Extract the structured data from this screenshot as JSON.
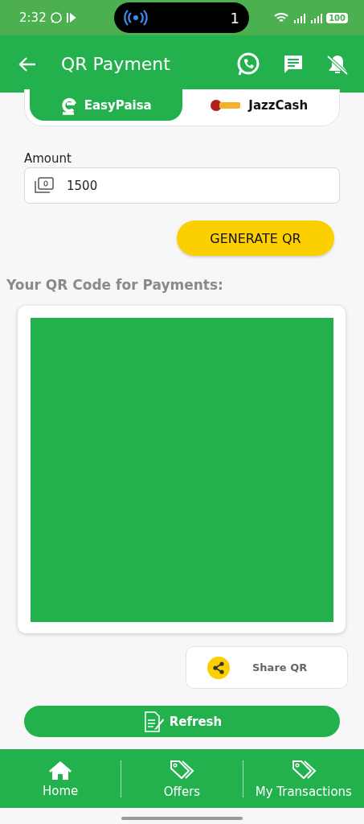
{
  "status_bar": {
    "time": "2:32",
    "notification_count": "1",
    "battery": "100"
  },
  "app_bar": {
    "title": "QR Payment"
  },
  "wallet_tabs": [
    {
      "label": "EasyPaisa",
      "selected": true
    },
    {
      "label": "JazzCash",
      "selected": false
    }
  ],
  "amount": {
    "label": "Amount",
    "value": "1500"
  },
  "generate_button": "GENERATE QR",
  "qr_heading": "Your QR Code for Payments:",
  "share_button": "Share QR",
  "refresh_button": "Refresh",
  "bottom_nav": [
    {
      "label": "Home",
      "kind": "home"
    },
    {
      "label": "Offers",
      "kind": "tag"
    },
    {
      "label": "My Transactions",
      "kind": "tag"
    }
  ]
}
